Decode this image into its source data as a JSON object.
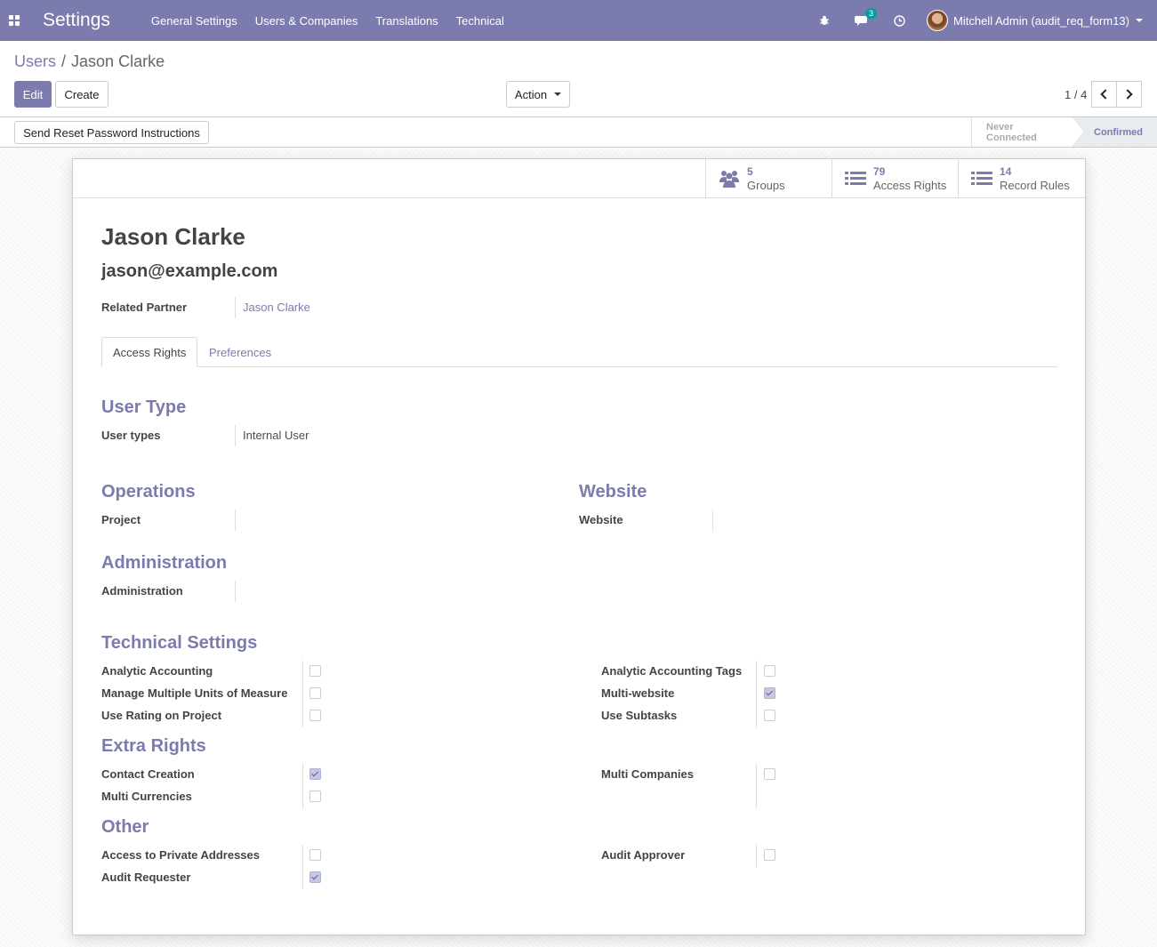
{
  "navbar": {
    "app_title": "Settings",
    "menu": [
      "General Settings",
      "Users & Companies",
      "Translations",
      "Technical"
    ],
    "messages_badge": "3",
    "user_name": "Mitchell Admin (audit_req_form13)",
    "icons": [
      "apps-grid-icon",
      "bug-icon",
      "chat-icon",
      "clock-icon"
    ]
  },
  "breadcrumb": {
    "parent": "Users",
    "separator": "/",
    "current": "Jason Clarke"
  },
  "toolbar": {
    "edit_label": "Edit",
    "create_label": "Create",
    "action_label": "Action",
    "pager": "1 / 4"
  },
  "statusbar": {
    "reset_button": "Send Reset Password Instructions",
    "steps": [
      "Never Connected",
      "Confirmed"
    ],
    "active_step": "Confirmed"
  },
  "smart_buttons": [
    {
      "count": "5",
      "label": "Groups",
      "icon": "users-icon"
    },
    {
      "count": "79",
      "label": "Access Rights",
      "icon": "list-icon"
    },
    {
      "count": "14",
      "label": "Record Rules",
      "icon": "list-icon"
    }
  ],
  "record": {
    "name": "Jason Clarke",
    "email": "jason@example.com",
    "related_partner_label": "Related Partner",
    "related_partner_value": "Jason Clarke"
  },
  "tabs": [
    "Access Rights",
    "Preferences"
  ],
  "sections": {
    "user_type": {
      "title": "User Type",
      "label": "User types",
      "value": "Internal User"
    },
    "operations": {
      "title": "Operations",
      "label": "Project",
      "value": ""
    },
    "website": {
      "title": "Website",
      "label": "Website",
      "value": ""
    },
    "administration": {
      "title": "Administration",
      "label": "Administration",
      "value": ""
    },
    "technical": {
      "title": "Technical Settings",
      "left": [
        {
          "label": "Analytic Accounting",
          "checked": false
        },
        {
          "label": "Manage Multiple Units of Measure",
          "checked": false
        },
        {
          "label": "Use Rating on Project",
          "checked": false
        }
      ],
      "right": [
        {
          "label": "Analytic Accounting Tags",
          "checked": false
        },
        {
          "label": "Multi-website",
          "checked": true
        },
        {
          "label": "Use Subtasks",
          "checked": false
        }
      ]
    },
    "extra": {
      "title": "Extra Rights",
      "left": [
        {
          "label": "Contact Creation",
          "checked": true
        },
        {
          "label": "Multi Currencies",
          "checked": false
        }
      ],
      "right": [
        {
          "label": "Multi Companies",
          "checked": false
        }
      ]
    },
    "other": {
      "title": "Other",
      "left": [
        {
          "label": "Access to Private Addresses",
          "checked": false
        },
        {
          "label": "Audit Requester",
          "checked": true
        }
      ],
      "right": [
        {
          "label": "Audit Approver",
          "checked": false
        }
      ]
    }
  }
}
